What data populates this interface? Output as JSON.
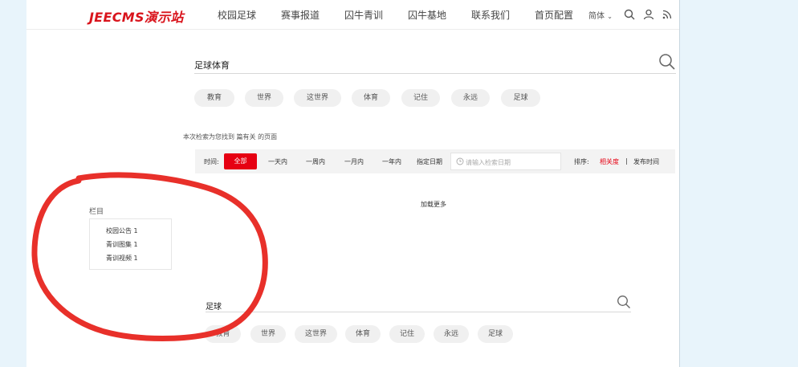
{
  "header": {
    "logo": "JEECMS演示站",
    "nav": [
      "校园足球",
      "赛事报道",
      "囚牛青训",
      "囚牛基地",
      "联系我们",
      "首页配置"
    ],
    "language": "简体",
    "icons": [
      "search-icon",
      "user-icon",
      "rss-icon"
    ]
  },
  "search": {
    "query": "足球体育",
    "tags": [
      "教育",
      "世界",
      "这世界",
      "体育",
      "记住",
      "永远",
      "足球"
    ]
  },
  "results": {
    "note_prefix": "本次检索为您找到",
    "note_mid": "篇有关",
    "note_suffix": "的页面"
  },
  "filter": {
    "time_label": "时间:",
    "active": "全部",
    "options": [
      "一天内",
      "一周内",
      "一月内",
      "一年内",
      "指定日期"
    ],
    "date_placeholder": "请输入检索日期",
    "sort_label": "排序:",
    "sort_active": "相关度",
    "separator": "|",
    "sort_other": "发布时间"
  },
  "load_more": "加载更多",
  "category": {
    "title": "栏目",
    "items": [
      "校园公告 1",
      "青训图集 1",
      "青训视频 1"
    ]
  },
  "second_search": {
    "query": "足球",
    "tags": [
      "教育",
      "世界",
      "这世界",
      "体育",
      "记住",
      "永远",
      "足球"
    ]
  },
  "colors": {
    "brand_red": "#d9141c",
    "active_red": "#e60012",
    "annotation_red": "#e8302a",
    "page_bg": "#e8f4fb"
  }
}
